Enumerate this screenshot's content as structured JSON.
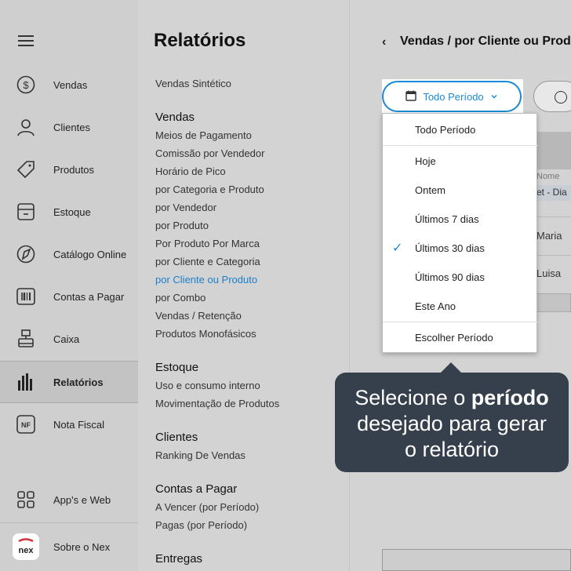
{
  "sidebar": {
    "items": [
      {
        "label": "Vendas",
        "icon": "dollar-circle-icon"
      },
      {
        "label": "Clientes",
        "icon": "user-icon"
      },
      {
        "label": "Produtos",
        "icon": "tag-icon"
      },
      {
        "label": "Estoque",
        "icon": "box-icon"
      },
      {
        "label": "Catálogo Online",
        "icon": "compass-icon"
      },
      {
        "label": "Contas a Pagar",
        "icon": "barcode-icon"
      },
      {
        "label": "Caixa",
        "icon": "register-icon"
      },
      {
        "label": "Relatórios",
        "icon": "bar-chart-icon"
      },
      {
        "label": "Nota Fiscal",
        "icon": "nf-icon"
      }
    ],
    "apps_label": "App's e Web",
    "about_label": "Sobre o Nex",
    "logo_text": "nex"
  },
  "reports": {
    "title": "Relatórios",
    "top_item": "Vendas Sintético",
    "sections": [
      {
        "heading": "Vendas",
        "items": [
          "Meios de Pagamento",
          "Comissão por Vendedor",
          "Horário de Pico",
          "por Categoria e Produto",
          "por Vendedor",
          "por Produto",
          "Por Produto Por Marca",
          "por Cliente e Categoria",
          "por Cliente ou Produto",
          "por Combo",
          "Vendas / Retenção",
          "Produtos Monofásicos"
        ]
      },
      {
        "heading": "Estoque",
        "items": [
          "Uso e consumo interno",
          "Movimentação de Produtos"
        ]
      },
      {
        "heading": "Clientes",
        "items": [
          "Ranking De Vendas"
        ]
      },
      {
        "heading": "Contas a Pagar",
        "items": [
          "A Vencer (por Período)",
          "Pagas (por Período)"
        ]
      },
      {
        "heading": "Entregas",
        "items": []
      }
    ]
  },
  "main": {
    "breadcrumb": "Vendas / por Cliente ou Produto",
    "period_button": "Todo Período",
    "table": {
      "column_label": "Nome",
      "row1": "et - Dia",
      "row2": "Maria",
      "row3": "Luisa"
    }
  },
  "dropdown": {
    "options": [
      "Todo Período",
      "Hoje",
      "Ontem",
      "Últimos 7 dias",
      "Últimos 30 dias",
      "Últimos 90 dias",
      "Este Ano",
      "Escolher Período"
    ],
    "selected": "Últimos 30 dias",
    "check": "✓"
  },
  "tooltip": {
    "line1_pre": "Selecione o ",
    "line1_bold": "período",
    "line2": "desejado para gerar",
    "line3": "o relatório"
  },
  "colors": {
    "accent": "#1a8ad4",
    "tooltip_bg": "#363f4c",
    "logo": "#d62f3a"
  }
}
